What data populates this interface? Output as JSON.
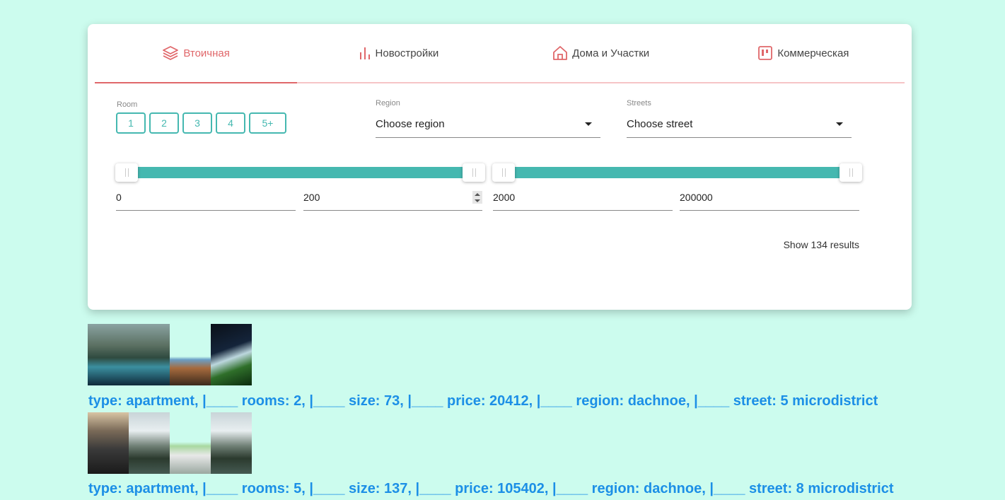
{
  "tabs": [
    {
      "label": "Втоичная",
      "icon": "layers-icon",
      "active": true
    },
    {
      "label": "Новостройки",
      "icon": "bar-chart-icon",
      "active": false
    },
    {
      "label": "Дома и Участки",
      "icon": "house-icon",
      "active": false
    },
    {
      "label": "Коммерческая",
      "icon": "board-icon",
      "active": false
    }
  ],
  "filters": {
    "room_label": "Room",
    "rooms": [
      "1",
      "2",
      "3",
      "4",
      "5+"
    ],
    "region_label": "Region",
    "region_value": "Choose region",
    "streets_label": "Streets",
    "street_value": "Choose street",
    "size_min": "0",
    "size_max": "200",
    "price_min": "2000",
    "price_max": "200000",
    "show_results": "Show 134 results"
  },
  "colors": {
    "accent": "#45b8b0",
    "tab_active": "#e0676a",
    "link_text": "#1c8fe6",
    "background": "#ccfcee"
  },
  "listings": [
    {
      "text": "type: apartment, |____ rooms: 2, |____ size: 73, |____ price: 20412, |____ region: dachnoe, |____ street: 5 microdistrict"
    },
    {
      "text": "type: apartment, |____ rooms: 5, |____ size: 137, |____ price: 105402, |____ region: dachnoe, |____ street: 8 microdistrict"
    }
  ]
}
